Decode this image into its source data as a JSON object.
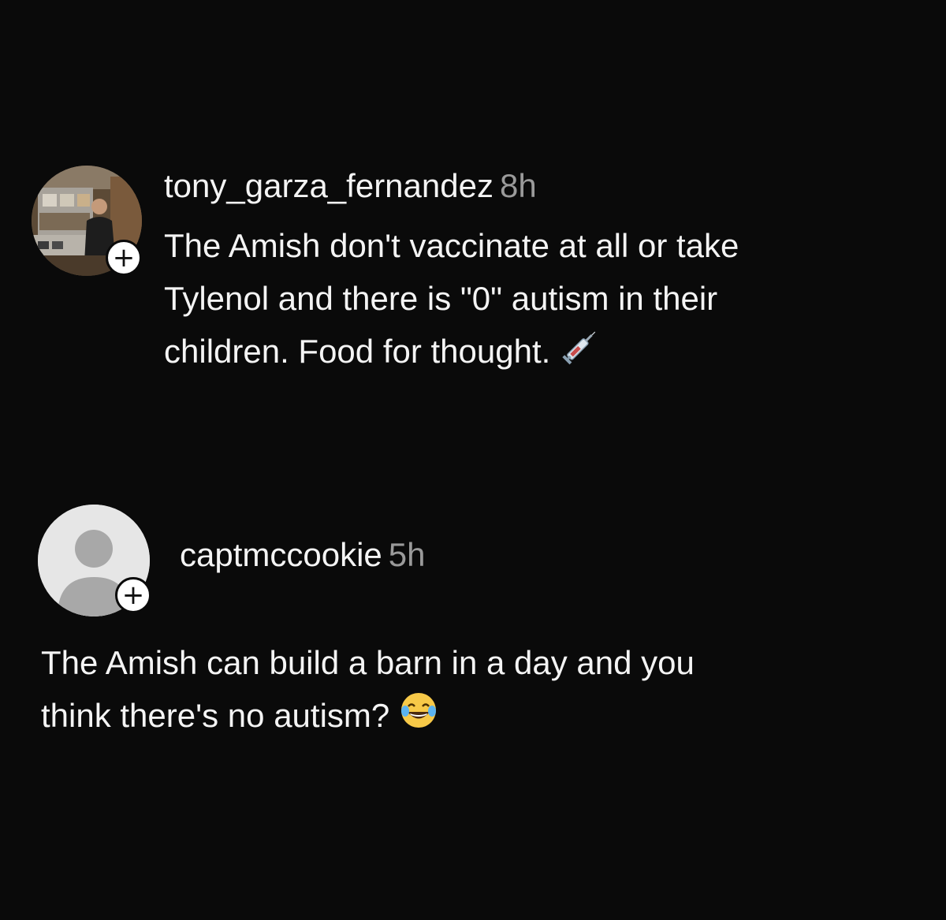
{
  "comments": [
    {
      "username": "tony_garza_fernandez",
      "time": "8h",
      "text_lines": [
        "The Amish don't vaccinate at all or take",
        "Tylenol and there is \"0\" autism in their",
        "children. Food for thought."
      ],
      "emoji": "syringe-emoji",
      "follow_badge": "+"
    },
    {
      "username": "captmccookie",
      "time": "5h",
      "text_lines": [
        "The Amish can build a barn in a day and you",
        "think there's no autism?"
      ],
      "emoji": "laughing-tears-emoji",
      "follow_badge": "+"
    }
  ],
  "colors": {
    "background": "#0a0a0a",
    "text": "#f4f4f4",
    "timestamp": "#9a9a9a",
    "badge": "#ffffff",
    "default_avatar": "#e6e6e6"
  }
}
